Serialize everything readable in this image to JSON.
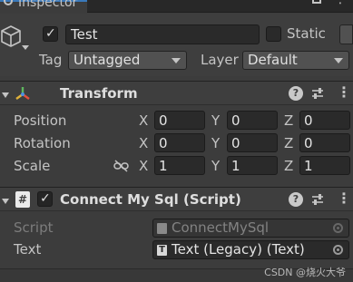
{
  "tab": {
    "label": "Inspector",
    "icon": "info-icon"
  },
  "header": {
    "object_name": "Test",
    "active": true,
    "static_label": "Static",
    "static": false,
    "tag_label": "Tag",
    "tag_value": "Untagged",
    "layer_label": "Layer",
    "layer_value": "Default"
  },
  "transform": {
    "title": "Transform",
    "rows": [
      {
        "label": "Position",
        "x": "0",
        "y": "0",
        "z": "0"
      },
      {
        "label": "Rotation",
        "x": "0",
        "y": "0",
        "z": "0"
      },
      {
        "label": "Scale",
        "x": "1",
        "y": "1",
        "z": "1"
      }
    ],
    "axes": {
      "x": "X",
      "y": "Y",
      "z": "Z"
    }
  },
  "script_component": {
    "title": "Connect My Sql (Script)",
    "enabled": true,
    "script_label": "Script",
    "script_value": "ConnectMySql",
    "text_label": "Text",
    "text_value": "Text (Legacy) (Text)"
  },
  "watermark": "CSDN @烧火大爷",
  "colors": {
    "accent": "#3a79bb",
    "background": "#3c3c3c",
    "field": "#2a2a2a"
  }
}
